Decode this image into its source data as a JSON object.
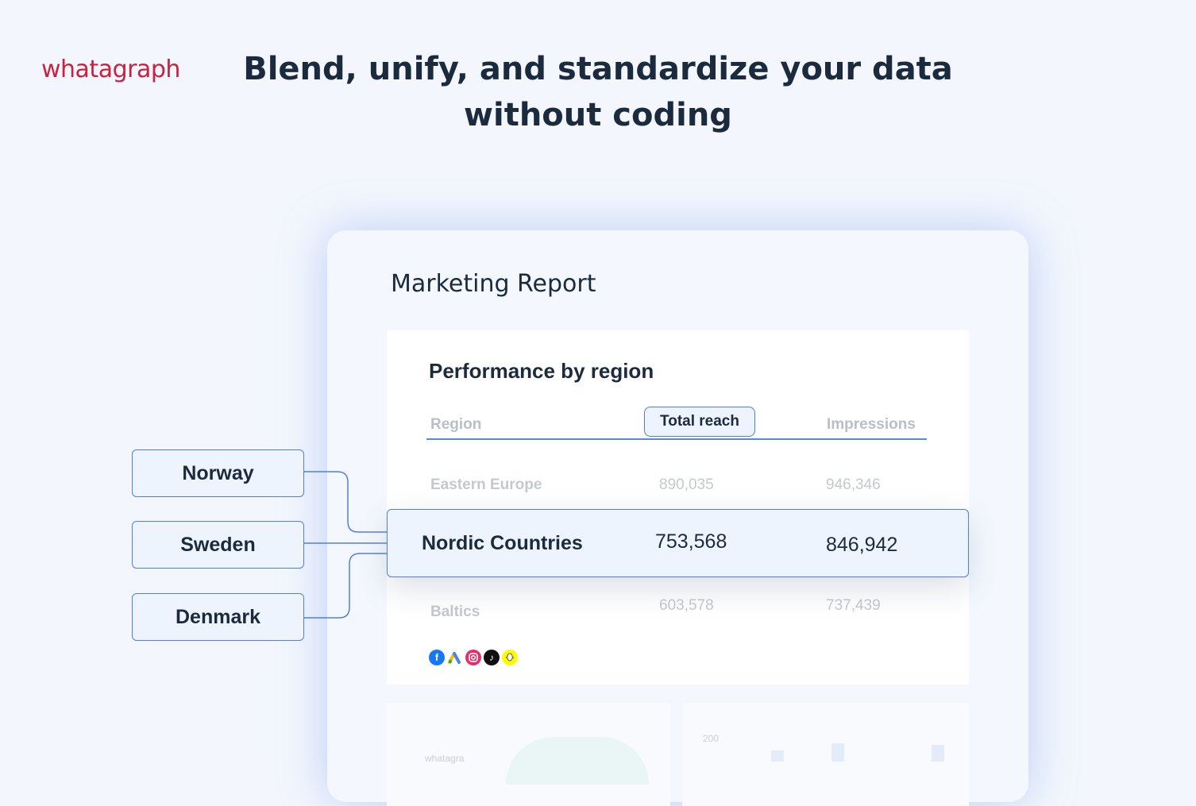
{
  "brand": {
    "logo_text": "whatagraph",
    "logo_color": "#c8223f"
  },
  "headline": {
    "line1": "Blend, unify, and standardize your data",
    "line2": "without coding"
  },
  "report": {
    "title": "Marketing Report",
    "widget": {
      "title": "Performance by region",
      "columns": {
        "region": "Region",
        "total_reach": "Total reach",
        "impressions": "Impressions"
      },
      "rows": [
        {
          "region": "Eastern Europe",
          "total_reach": "890,035",
          "impressions": "946,346"
        },
        {
          "region": "Nordic Countries",
          "total_reach": "753,568",
          "impressions": "846,942"
        },
        {
          "region": "Baltics",
          "total_reach": "603,578",
          "impressions": "737,439"
        }
      ],
      "source_icons": [
        "facebook-icon",
        "google-ads-icon",
        "instagram-icon",
        "tiktok-icon",
        "snapchat-icon"
      ]
    },
    "ghost_chart": {
      "axis_tick": "200",
      "watermark": "whatagra"
    }
  },
  "countries": [
    "Norway",
    "Sweden",
    "Denmark"
  ],
  "colors": {
    "accent": "#4f7fe6",
    "heading": "#1b2b3d",
    "faded": "#c4c9d1"
  }
}
